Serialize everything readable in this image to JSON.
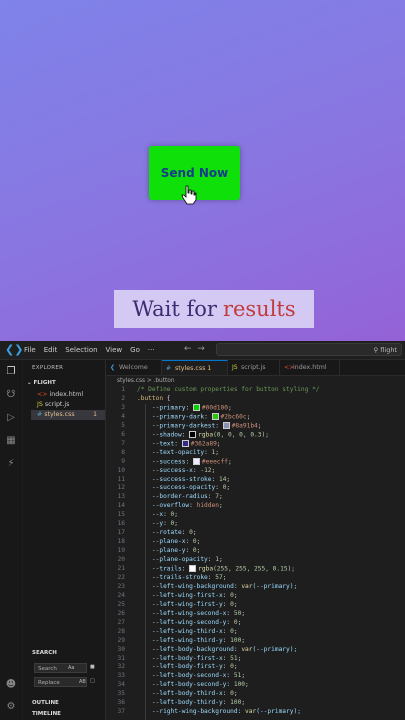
{
  "preview": {
    "button_label": "Send Now",
    "caption_part1": "Wait for",
    "caption_part2": "results"
  },
  "menubar": {
    "items": [
      "File",
      "Edit",
      "Selection",
      "View",
      "Go",
      "···"
    ],
    "search_text": "flight"
  },
  "sidebar": {
    "title": "EXPLORER",
    "folder": "FLIGHT",
    "files": [
      {
        "name": "index.html",
        "icon": "html-icon",
        "color": "#e44d26"
      },
      {
        "name": "script.js",
        "icon": "js-icon",
        "color": "#cbcb41"
      },
      {
        "name": "styles.css",
        "icon": "css-icon",
        "color": "#519aba",
        "badge": "1"
      }
    ],
    "search_title": "SEARCH",
    "search_placeholder": "Search",
    "search_opt": "Aa",
    "replace_placeholder": "Replace",
    "replace_opt": "AB",
    "outline": "OUTLINE",
    "timeline": "TIMELINE"
  },
  "tabs": [
    {
      "label": "Welcome",
      "icon": "vscode-icon"
    },
    {
      "label": "styles.css 1",
      "icon": "css-icon",
      "active": true
    },
    {
      "label": "script.js",
      "icon": "js-icon"
    },
    {
      "label": "index.html",
      "icon": "html-icon"
    }
  ],
  "breadcrumb": "styles.css > .button",
  "code_lines": [
    {
      "n": "1",
      "parts": [
        {
          "t": "/* Define custom properties for button styling */",
          "c": "c-comment"
        }
      ]
    },
    {
      "n": "2",
      "parts": [
        {
          "t": ".button",
          "c": "c-sel"
        },
        {
          "t": " {",
          "c": "c-punc"
        }
      ]
    },
    {
      "n": "3",
      "parts": [
        {
          "t": "    --primary",
          "c": "c-prop"
        },
        {
          "t": ": ",
          "c": "c-punc"
        },
        {
          "sw": "#00d100"
        },
        {
          "t": "#00d100",
          "c": "c-kw"
        },
        {
          "t": ";",
          "c": "c-punc"
        }
      ]
    },
    {
      "n": "4",
      "parts": [
        {
          "t": "    --primary-dark",
          "c": "c-prop"
        },
        {
          "t": ": ",
          "c": "c-punc"
        },
        {
          "sw": "#2bc60c"
        },
        {
          "t": "#2bc60c",
          "c": "c-kw"
        },
        {
          "t": ";",
          "c": "c-punc"
        }
      ]
    },
    {
      "n": "5",
      "parts": [
        {
          "t": "    --primary-darkest",
          "c": "c-prop"
        },
        {
          "t": ": ",
          "c": "c-punc"
        },
        {
          "sw": "#8a91b4"
        },
        {
          "t": "#8a91b4",
          "c": "c-kw"
        },
        {
          "t": ";",
          "c": "c-punc"
        }
      ]
    },
    {
      "n": "6",
      "parts": [
        {
          "t": "    --shadow",
          "c": "c-prop"
        },
        {
          "t": ": ",
          "c": "c-punc"
        },
        {
          "sw": "#000000"
        },
        {
          "t": "rgba",
          "c": "c-fn"
        },
        {
          "t": "(0, 0, 0, 0.3);",
          "c": "c-num"
        }
      ]
    },
    {
      "n": "7",
      "parts": [
        {
          "t": "    --text",
          "c": "c-prop"
        },
        {
          "t": ": ",
          "c": "c-punc"
        },
        {
          "sw": "#362a89"
        },
        {
          "t": "#362a89",
          "c": "c-kw"
        },
        {
          "t": ";",
          "c": "c-punc"
        }
      ]
    },
    {
      "n": "8",
      "parts": [
        {
          "t": "    --text-opacity",
          "c": "c-prop"
        },
        {
          "t": ": ",
          "c": "c-punc"
        },
        {
          "t": "1",
          "c": "c-num"
        },
        {
          "t": ";",
          "c": "c-punc"
        }
      ]
    },
    {
      "n": "9",
      "parts": [
        {
          "t": "    --success",
          "c": "c-prop"
        },
        {
          "t": ": ",
          "c": "c-punc"
        },
        {
          "sw": "#eeecff"
        },
        {
          "t": "#eeecff",
          "c": "c-kw"
        },
        {
          "t": ";",
          "c": "c-punc"
        }
      ]
    },
    {
      "n": "10",
      "parts": [
        {
          "t": "    --success-x",
          "c": "c-prop"
        },
        {
          "t": ": ",
          "c": "c-punc"
        },
        {
          "t": "-12",
          "c": "c-num"
        },
        {
          "t": ";",
          "c": "c-punc"
        }
      ]
    },
    {
      "n": "11",
      "parts": [
        {
          "t": "    --success-stroke",
          "c": "c-prop"
        },
        {
          "t": ": ",
          "c": "c-punc"
        },
        {
          "t": "14",
          "c": "c-num"
        },
        {
          "t": ";",
          "c": "c-punc"
        }
      ]
    },
    {
      "n": "12",
      "parts": [
        {
          "t": "    --success-opacity",
          "c": "c-prop"
        },
        {
          "t": ": ",
          "c": "c-punc"
        },
        {
          "t": "0",
          "c": "c-num"
        },
        {
          "t": ";",
          "c": "c-punc"
        }
      ]
    },
    {
      "n": "13",
      "parts": [
        {
          "t": "    --border-radius",
          "c": "c-prop"
        },
        {
          "t": ": ",
          "c": "c-punc"
        },
        {
          "t": "7",
          "c": "c-num"
        },
        {
          "t": ";",
          "c": "c-punc"
        }
      ]
    },
    {
      "n": "14",
      "parts": [
        {
          "t": "    --overflow",
          "c": "c-prop"
        },
        {
          "t": ": ",
          "c": "c-punc"
        },
        {
          "t": "hidden",
          "c": "c-kw"
        },
        {
          "t": ";",
          "c": "c-punc"
        }
      ]
    },
    {
      "n": "15",
      "parts": [
        {
          "t": "    --x",
          "c": "c-prop"
        },
        {
          "t": ": ",
          "c": "c-punc"
        },
        {
          "t": "0",
          "c": "c-num"
        },
        {
          "t": ";",
          "c": "c-punc"
        }
      ]
    },
    {
      "n": "16",
      "parts": [
        {
          "t": "    --y",
          "c": "c-prop"
        },
        {
          "t": ": ",
          "c": "c-punc"
        },
        {
          "t": "0",
          "c": "c-num"
        },
        {
          "t": ";",
          "c": "c-punc"
        }
      ]
    },
    {
      "n": "17",
      "parts": [
        {
          "t": "    --rotate",
          "c": "c-prop"
        },
        {
          "t": ": ",
          "c": "c-punc"
        },
        {
          "t": "0",
          "c": "c-num"
        },
        {
          "t": ";",
          "c": "c-punc"
        }
      ]
    },
    {
      "n": "18",
      "parts": [
        {
          "t": "    --plane-x",
          "c": "c-prop"
        },
        {
          "t": ": ",
          "c": "c-punc"
        },
        {
          "t": "0",
          "c": "c-num"
        },
        {
          "t": ";",
          "c": "c-punc"
        }
      ]
    },
    {
      "n": "19",
      "parts": [
        {
          "t": "    --plane-y",
          "c": "c-prop"
        },
        {
          "t": ": ",
          "c": "c-punc"
        },
        {
          "t": "0",
          "c": "c-num"
        },
        {
          "t": ";",
          "c": "c-punc"
        }
      ]
    },
    {
      "n": "20",
      "parts": [
        {
          "t": "    --plane-opacity",
          "c": "c-prop"
        },
        {
          "t": ": ",
          "c": "c-punc"
        },
        {
          "t": "1",
          "c": "c-num"
        },
        {
          "t": ";",
          "c": "c-punc"
        }
      ]
    },
    {
      "n": "21",
      "parts": [
        {
          "t": "    --trails",
          "c": "c-prop"
        },
        {
          "t": ": ",
          "c": "c-punc"
        },
        {
          "sw": "#ffffff"
        },
        {
          "t": "rgba",
          "c": "c-fn"
        },
        {
          "t": "(255, 255, 255, 0.15);",
          "c": "c-num"
        }
      ]
    },
    {
      "n": "22",
      "parts": [
        {
          "t": "    --trails-stroke",
          "c": "c-prop"
        },
        {
          "t": ": ",
          "c": "c-punc"
        },
        {
          "t": "57",
          "c": "c-num"
        },
        {
          "t": ";",
          "c": "c-punc"
        }
      ]
    },
    {
      "n": "23",
      "parts": [
        {
          "t": "    --left-wing-background",
          "c": "c-prop"
        },
        {
          "t": ": ",
          "c": "c-punc"
        },
        {
          "t": "var",
          "c": "c-fn"
        },
        {
          "t": "(--primary);",
          "c": "c-prop"
        }
      ]
    },
    {
      "n": "24",
      "parts": [
        {
          "t": "    --left-wing-first-x",
          "c": "c-prop"
        },
        {
          "t": ": ",
          "c": "c-punc"
        },
        {
          "t": "0",
          "c": "c-num"
        },
        {
          "t": ";",
          "c": "c-punc"
        }
      ]
    },
    {
      "n": "25",
      "parts": [
        {
          "t": "    --left-wing-first-y",
          "c": "c-prop"
        },
        {
          "t": ": ",
          "c": "c-punc"
        },
        {
          "t": "0",
          "c": "c-num"
        },
        {
          "t": ";",
          "c": "c-punc"
        }
      ]
    },
    {
      "n": "26",
      "parts": [
        {
          "t": "    --left-wing-second-x",
          "c": "c-prop"
        },
        {
          "t": ": ",
          "c": "c-punc"
        },
        {
          "t": "50",
          "c": "c-num"
        },
        {
          "t": ";",
          "c": "c-punc"
        }
      ]
    },
    {
      "n": "27",
      "parts": [
        {
          "t": "    --left-wing-second-y",
          "c": "c-prop"
        },
        {
          "t": ": ",
          "c": "c-punc"
        },
        {
          "t": "0",
          "c": "c-num"
        },
        {
          "t": ";",
          "c": "c-punc"
        }
      ]
    },
    {
      "n": "28",
      "parts": [
        {
          "t": "    --left-wing-third-x",
          "c": "c-prop"
        },
        {
          "t": ": ",
          "c": "c-punc"
        },
        {
          "t": "0",
          "c": "c-num"
        },
        {
          "t": ";",
          "c": "c-punc"
        }
      ]
    },
    {
      "n": "29",
      "parts": [
        {
          "t": "    --left-wing-third-y",
          "c": "c-prop"
        },
        {
          "t": ": ",
          "c": "c-punc"
        },
        {
          "t": "100",
          "c": "c-num"
        },
        {
          "t": ";",
          "c": "c-punc"
        }
      ]
    },
    {
      "n": "30",
      "parts": [
        {
          "t": "    --left-body-background",
          "c": "c-prop"
        },
        {
          "t": ": ",
          "c": "c-punc"
        },
        {
          "t": "var",
          "c": "c-fn"
        },
        {
          "t": "(--primary);",
          "c": "c-prop"
        }
      ]
    },
    {
      "n": "31",
      "parts": [
        {
          "t": "    --left-body-first-x",
          "c": "c-prop"
        },
        {
          "t": ": ",
          "c": "c-punc"
        },
        {
          "t": "51",
          "c": "c-num"
        },
        {
          "t": ";",
          "c": "c-punc"
        }
      ]
    },
    {
      "n": "32",
      "parts": [
        {
          "t": "    --left-body-first-y",
          "c": "c-prop"
        },
        {
          "t": ": ",
          "c": "c-punc"
        },
        {
          "t": "0",
          "c": "c-num"
        },
        {
          "t": ";",
          "c": "c-punc"
        }
      ]
    },
    {
      "n": "33",
      "parts": [
        {
          "t": "    --left-body-second-x",
          "c": "c-prop"
        },
        {
          "t": ": ",
          "c": "c-punc"
        },
        {
          "t": "51",
          "c": "c-num"
        },
        {
          "t": ";",
          "c": "c-punc"
        }
      ]
    },
    {
      "n": "34",
      "parts": [
        {
          "t": "    --left-body-second-y",
          "c": "c-prop"
        },
        {
          "t": ": ",
          "c": "c-punc"
        },
        {
          "t": "100",
          "c": "c-num"
        },
        {
          "t": ";",
          "c": "c-punc"
        }
      ]
    },
    {
      "n": "35",
      "parts": [
        {
          "t": "    --left-body-third-x",
          "c": "c-prop"
        },
        {
          "t": ": ",
          "c": "c-punc"
        },
        {
          "t": "0",
          "c": "c-num"
        },
        {
          "t": ";",
          "c": "c-punc"
        }
      ]
    },
    {
      "n": "36",
      "parts": [
        {
          "t": "    --left-body-third-y",
          "c": "c-prop"
        },
        {
          "t": ": ",
          "c": "c-punc"
        },
        {
          "t": "100",
          "c": "c-num"
        },
        {
          "t": ";",
          "c": "c-punc"
        }
      ]
    },
    {
      "n": "37",
      "parts": [
        {
          "t": "    --right-wing-background",
          "c": "c-prop"
        },
        {
          "t": ": ",
          "c": "c-punc"
        },
        {
          "t": "var",
          "c": "c-fn"
        },
        {
          "t": "(--primary);",
          "c": "c-prop"
        }
      ]
    }
  ]
}
